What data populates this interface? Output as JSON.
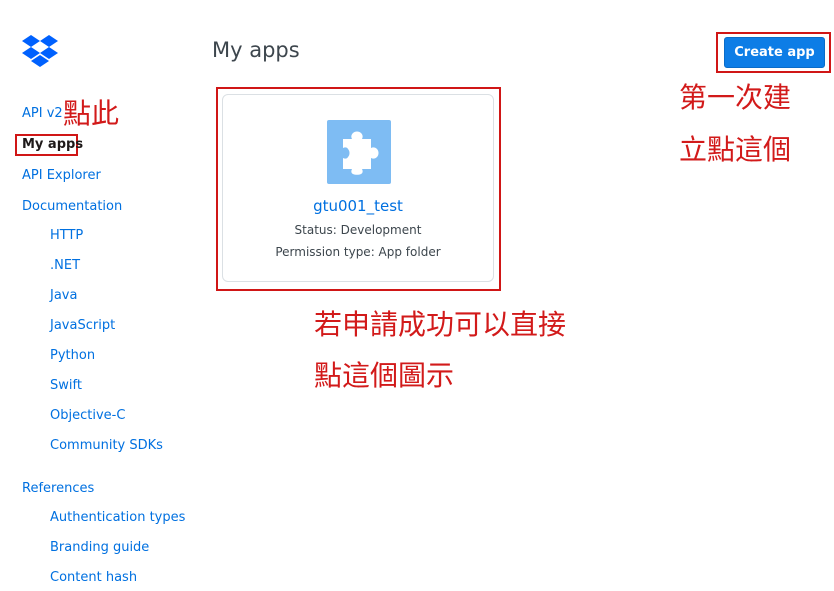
{
  "logo": {
    "icon": "dropbox-logo-icon",
    "color": "#0061fe"
  },
  "sidebar": {
    "items": [
      {
        "label": "API v2"
      },
      {
        "label": "My apps"
      },
      {
        "label": "API Explorer"
      },
      {
        "label": "Documentation"
      },
      {
        "label": "HTTP"
      },
      {
        "label": ".NET"
      },
      {
        "label": "Java"
      },
      {
        "label": "JavaScript"
      },
      {
        "label": "Python"
      },
      {
        "label": "Swift"
      },
      {
        "label": "Objective-C"
      },
      {
        "label": "Community SDKs"
      },
      {
        "label": "References"
      },
      {
        "label": "Authentication types"
      },
      {
        "label": "Branding guide"
      },
      {
        "label": "Content hash"
      }
    ]
  },
  "main": {
    "title": "My apps",
    "create_button_label": "Create app",
    "app_card": {
      "icon": "puzzle-piece-icon",
      "name": "gtu001_test",
      "status": "Status: Development",
      "permission": "Permission type: App folder"
    }
  },
  "annotations": {
    "click_here": "點此",
    "first_time_line1": "第一次建",
    "first_time_line2": "立點這個",
    "success_line1": "若申請成功可以直接",
    "success_line2": "點這個圖示",
    "color": "#d21a1a"
  },
  "colors": {
    "link": "#0070e0",
    "primary_button": "#0d7de6",
    "highlight_box": "#d01616",
    "app_icon_bg": "#7ebcf3"
  }
}
